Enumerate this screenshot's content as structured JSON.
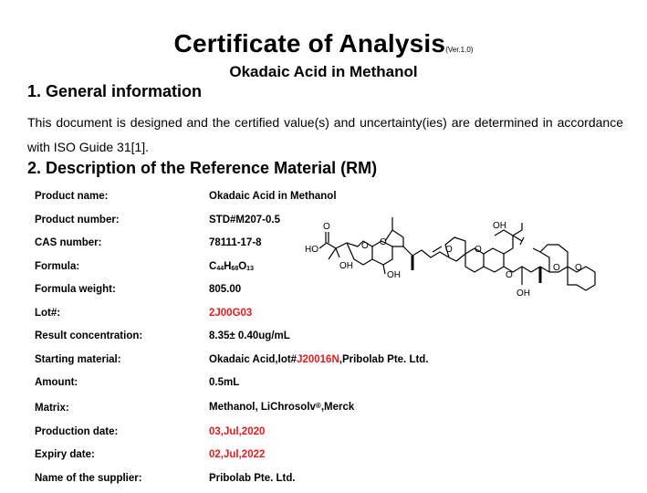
{
  "header": {
    "title": "Certificate of Analysis",
    "version": "(Ver.1.0)",
    "subtitle": "Okadaic Acid in Methanol"
  },
  "section1": {
    "heading": "1. General information",
    "paragraph": "This document is designed and the certified value(s) and uncertainty(ies) are determined in accordance with ISO Guide 31[1]."
  },
  "section2": {
    "heading": "2. Description of the Reference Material (RM)",
    "rows": {
      "product_name": {
        "label": "Product name:",
        "value": "Okadaic Acid in Methanol"
      },
      "product_number": {
        "label": "Product number:",
        "value": "STD#M207-0.5"
      },
      "cas_number": {
        "label": "CAS number:",
        "value": "78111-17-8"
      },
      "formula": {
        "label": "Formula:",
        "c": "C",
        "c_sub": "44",
        "h": "H",
        "h_sub": "68",
        "o": "O",
        "o_sub": "13"
      },
      "formula_weight": {
        "label": "Formula weight:",
        "value": "805.00"
      },
      "lot": {
        "label": "Lot#:",
        "value": "2J00G03"
      },
      "result_concentration": {
        "label": "Result concentration:",
        "value": "8.35± 0.40ug/mL"
      },
      "starting_material": {
        "label": "Starting material:",
        "prefix": "Okadaic Acid,lot#",
        "lot": "J20016N",
        "suffix": ",Pribolab Pte. Ltd."
      },
      "amount": {
        "label": "Amount:",
        "value": "0.5mL"
      },
      "matrix": {
        "label": "Matrix:",
        "prefix": "Methanol, LiChrosolv",
        "reg": "®",
        "suffix": ",Merck"
      },
      "production_date": {
        "label": "Production date:",
        "value": "03,Jul,2020"
      },
      "expiry_date": {
        "label": "Expiry date:",
        "value": "02,Jul,2022"
      },
      "supplier": {
        "label": "Name of the supplier:",
        "value": "Pribolab Pte. Ltd."
      }
    },
    "structure": {
      "labels": {
        "o_carbonyl": "O",
        "ho": "HO",
        "oh1": "OH",
        "o1": "O",
        "o2": "O",
        "oh2": "OH",
        "o3": "O",
        "o4": "O",
        "oh_top": "OH",
        "o5": "O",
        "oh3": "OH",
        "o6": "O",
        "o7": "O"
      }
    }
  },
  "colors": {
    "accent_red": "#e02020"
  }
}
